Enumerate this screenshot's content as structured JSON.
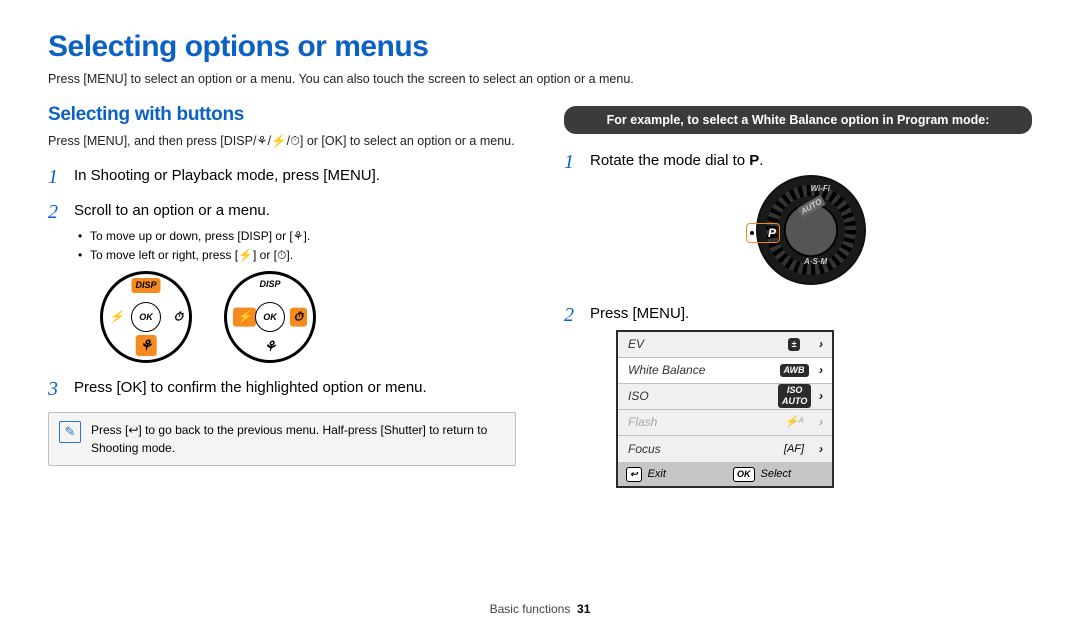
{
  "title": "Selecting options or menus",
  "intro": "Press [MENU] to select an option or a menu. You can also touch the screen to select an option or a menu.",
  "left": {
    "heading": "Selecting with buttons",
    "instruction": "Press [MENU], and then press [DISP/⚘/⚡/⏱] or [OK] to select an option or a menu.",
    "step1": "In Shooting or Playback mode, press [MENU].",
    "step2": "Scroll to an option or a menu.",
    "step2_sub1": "To move up or down, press [DISP] or [⚘].",
    "step2_sub2": "To move left or right, press [⚡] or [⏱].",
    "step3": "Press [OK] to confirm the highlighted option or menu.",
    "note": "Press [↩] to go back to the previous menu. Half-press [Shutter] to return to Shooting mode.",
    "dial": {
      "disp": "DISP",
      "ok": "OK",
      "flash": "⚡",
      "timer": "⏱",
      "macro": "⚘"
    }
  },
  "right": {
    "banner": "For example, to select a White Balance option in Program mode:",
    "step1_a": "Rotate the mode dial to ",
    "step1_b": "P",
    "step1_c": ".",
    "step2": "Press [MENU].",
    "mode_dial": {
      "wifi": "Wi-Fi",
      "auto": "AUTO",
      "asm": "A·S·M",
      "p": "P"
    },
    "menu": {
      "rows": [
        {
          "label": "EV",
          "icon": "±",
          "icon_class": "badge-dark",
          "disabled": false
        },
        {
          "label": "White Balance",
          "icon": "AWB",
          "icon_class": "badge-dark",
          "disabled": false,
          "highlight": true
        },
        {
          "label": "ISO",
          "icon": "ISO\nAUTO",
          "icon_class": "badge-dark",
          "disabled": false
        },
        {
          "label": "Flash",
          "icon": "⚡ᴬ",
          "icon_class": "",
          "disabled": true
        },
        {
          "label": "Focus",
          "icon": "[AF]",
          "icon_class": "",
          "disabled": false
        }
      ],
      "footer_exit_icon": "↩",
      "footer_exit": "Exit",
      "footer_select_key": "OK",
      "footer_select": "Select"
    }
  },
  "footer": {
    "section": "Basic functions",
    "page": "31"
  }
}
